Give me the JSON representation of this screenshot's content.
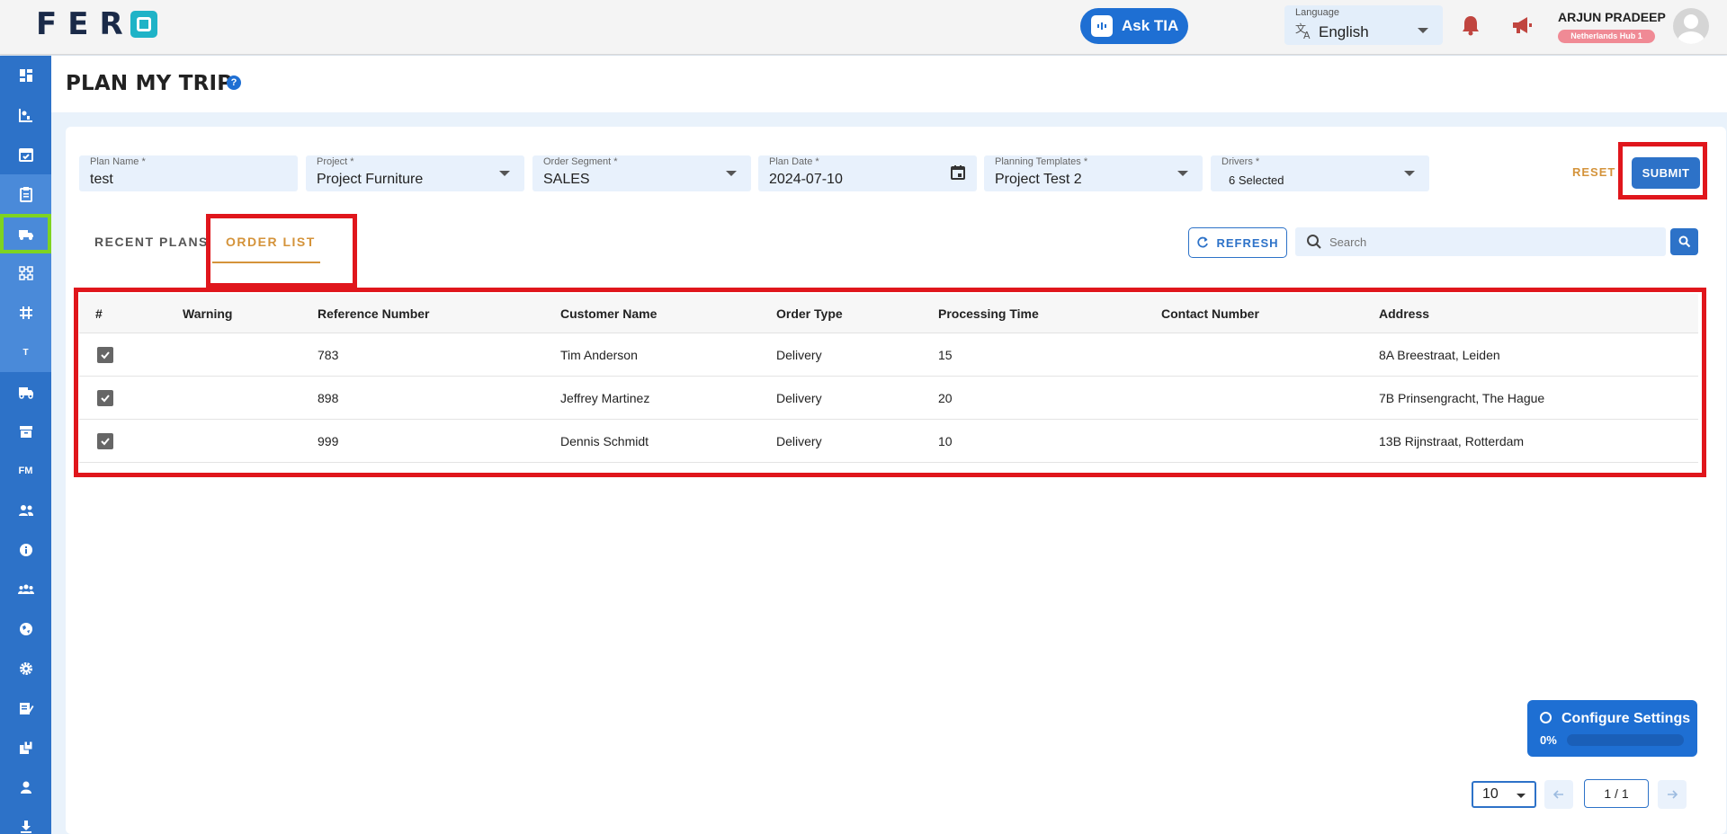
{
  "brand": {
    "logo_text": "FER"
  },
  "header": {
    "ask_tia": "Ask TIA",
    "language_label": "Language",
    "language_value": "English",
    "user_name": "ARJUN PRADEEP",
    "hub_badge": "Netherlands Hub 1"
  },
  "sidebar": {
    "items": [
      {
        "icon": "dashboard-icon"
      },
      {
        "icon": "analytics-icon"
      },
      {
        "icon": "calendar-check-icon"
      },
      {
        "icon": "clipboard-icon"
      },
      {
        "icon": "truck-plan-icon",
        "active": true
      },
      {
        "icon": "route-icon"
      },
      {
        "icon": "grid-hash-icon"
      },
      {
        "icon": "t-letter-icon",
        "text": "T"
      },
      {
        "icon": "truck-icon"
      },
      {
        "icon": "archive-icon"
      },
      {
        "icon": "fm-icon",
        "text": "FM"
      },
      {
        "icon": "people-icon"
      },
      {
        "icon": "info-icon"
      },
      {
        "icon": "group-icon"
      },
      {
        "icon": "globe-icon"
      },
      {
        "icon": "settings-icon"
      },
      {
        "icon": "edit-note-icon"
      },
      {
        "icon": "package-icon"
      },
      {
        "icon": "person-icon"
      },
      {
        "icon": "download-icon"
      }
    ]
  },
  "page": {
    "title": "PLAN MY TRIP"
  },
  "form": {
    "plan_name": {
      "label": "Plan Name *",
      "value": "test"
    },
    "project": {
      "label": "Project *",
      "value": "Project Furniture"
    },
    "order_segment": {
      "label": "Order Segment *",
      "value": "SALES"
    },
    "plan_date": {
      "label": "Plan Date *",
      "value": "2024-07-10"
    },
    "planning_templates": {
      "label": "Planning Templates *",
      "value": "Project Test 2"
    },
    "drivers": {
      "label": "Drivers *",
      "value": "6 Selected"
    },
    "reset": "RESET",
    "submit": "SUBMIT"
  },
  "tabs": {
    "recent_plans": "RECENT PLANS",
    "order_list": "ORDER LIST"
  },
  "toolbar": {
    "refresh": "REFRESH",
    "search_placeholder": "Search"
  },
  "table": {
    "columns": [
      "#",
      "Warning",
      "Reference Number",
      "Customer Name",
      "Order Type",
      "Processing Time",
      "Contact Number",
      "Address"
    ],
    "rows": [
      {
        "checked": true,
        "warning": "",
        "reference": "783",
        "customer": "Tim Anderson",
        "type": "Delivery",
        "processing": "15",
        "contact": "",
        "address": "8A Breestraat, Leiden"
      },
      {
        "checked": true,
        "warning": "",
        "reference": "898",
        "customer": "Jeffrey Martinez",
        "type": "Delivery",
        "processing": "20",
        "contact": "",
        "address": "7B Prinsengracht, The Hague"
      },
      {
        "checked": true,
        "warning": "",
        "reference": "999",
        "customer": "Dennis Schmidt",
        "type": "Delivery",
        "processing": "10",
        "contact": "",
        "address": "13B Rijnstraat, Rotterdam"
      }
    ]
  },
  "config": {
    "title": "Configure Settings",
    "percent_text": "0%",
    "progress": 0
  },
  "pagination": {
    "page_size": "10",
    "page_info": "1 / 1"
  },
  "colors": {
    "accent": "#2d72c8",
    "tab_active": "#d4933a",
    "highlight": "#e0161c",
    "active_sidebar_border": "#7ed321"
  }
}
